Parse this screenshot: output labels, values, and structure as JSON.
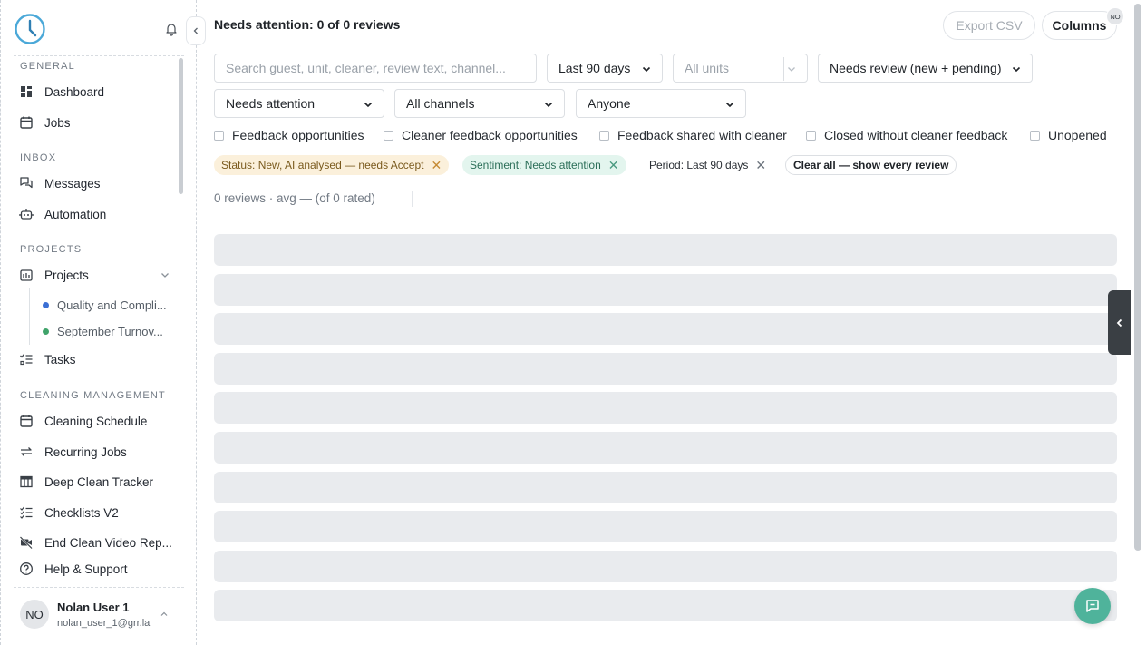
{
  "sidebar": {
    "sections": {
      "general": "GENERAL",
      "inbox": "INBOX",
      "projects": "PROJECTS",
      "cleaning": "CLEANING MANAGEMENT"
    },
    "items": {
      "dashboard": "Dashboard",
      "jobs": "Jobs",
      "messages": "Messages",
      "automation": "Automation",
      "projects": "Projects",
      "tasks": "Tasks",
      "cleaning_schedule": "Cleaning Schedule",
      "recurring_jobs": "Recurring Jobs",
      "deep_clean_tracker": "Deep Clean Tracker",
      "checklists_v2": "Checklists V2",
      "end_clean_video": "End Clean Video Rep...",
      "help_support": "Help & Support"
    },
    "sub_projects": [
      {
        "label": "Quality and Compli...",
        "color": "#3b6fd4"
      },
      {
        "label": "September Turnov...",
        "color": "#3fa36a"
      }
    ],
    "user": {
      "initials": "NO",
      "name": "Nolan User 1",
      "email": "nolan_user_1@grr.la"
    }
  },
  "header": {
    "title": "Needs attention: 0 of 0 reviews",
    "export_label": "Export CSV",
    "columns_label": "Columns",
    "columns_badge": "NO"
  },
  "filters": {
    "search_placeholder": "Search guest, unit, cleaner, review text, channel...",
    "period": "Last 90 days",
    "units_placeholder": "All units",
    "status": "Needs review (new + pending)",
    "sentiment": "Needs attention",
    "channels": "All channels",
    "assignee": "Anyone"
  },
  "checkboxes": [
    "Feedback opportunities",
    "Cleaner feedback opportunities",
    "Feedback shared with cleaner",
    "Closed without cleaner feedback",
    "Unopened"
  ],
  "chips": {
    "status": "Status: New, AI analysed — needs Accept",
    "sentiment": "Sentiment: Needs attention",
    "period": "Period: Last 90 days",
    "clear": "Clear all — show every review",
    "close_glyph": "✕"
  },
  "summary": "0 reviews · avg — (of 0 rated)",
  "skeleton_rows": 10,
  "colors": {
    "accent": "#4fb39b",
    "skeleton": "#e9ebee",
    "status_chip": "#fbf0db",
    "sentiment_chip": "#e3f5ee"
  }
}
